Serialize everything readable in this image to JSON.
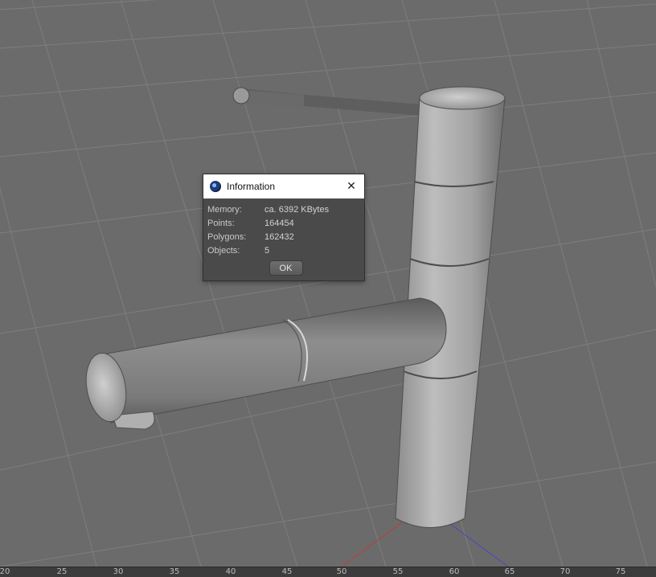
{
  "dialog": {
    "title": "Information",
    "icon": "cinema4d-app-icon",
    "rows": [
      {
        "label": "Memory:",
        "value": "ca. 6392 KBytes"
      },
      {
        "label": "Points:",
        "value": "164454"
      },
      {
        "label": "Polygons:",
        "value": "162432"
      },
      {
        "label": "Objects:",
        "value": "5"
      }
    ],
    "ok_label": "OK",
    "close_icon": "close-icon"
  },
  "timeline": {
    "ticks": [
      "20",
      "25",
      "30",
      "35",
      "40",
      "45",
      "50",
      "55",
      "60",
      "65",
      "70",
      "75"
    ]
  },
  "colors": {
    "viewport_bg": "#6b6b6b",
    "grid_line": "#7c7c7c",
    "dialog_bg": "#4a4a4a",
    "titlebar_bg": "#ffffff",
    "axis_x": "#d23a3a",
    "axis_z": "#4a4ad8"
  }
}
